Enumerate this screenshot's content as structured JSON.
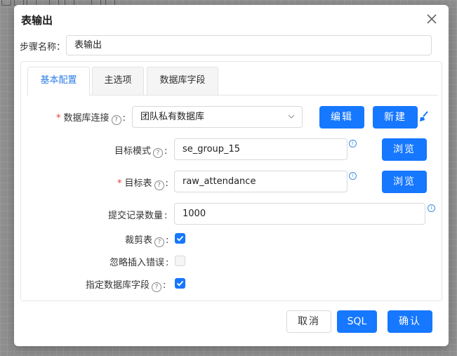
{
  "dialog": {
    "title": "表输出",
    "step_name_label": "步骤名称：",
    "step_name_value": "表输出"
  },
  "tabs": [
    {
      "label": "基本配置",
      "active": true
    },
    {
      "label": "主选项",
      "active": false
    },
    {
      "label": "数据库字段",
      "active": false
    }
  ],
  "form": {
    "db_connection": {
      "label": "数据库连接",
      "required": true,
      "value": "团队私有数据库"
    },
    "target_schema": {
      "label": "目标模式",
      "required": false,
      "value": "se_group_15"
    },
    "target_table": {
      "label": "目标表",
      "required": true,
      "value": "raw_attendance"
    },
    "commit_size": {
      "label": "提交记录数量",
      "value": "1000"
    },
    "truncate_table": {
      "label": "裁剪表",
      "checked": true
    },
    "ignore_insert_errors": {
      "label": "忽略插入错误",
      "checked": false
    },
    "specify_db_fields": {
      "label": "指定数据库字段",
      "checked": true
    }
  },
  "buttons": {
    "edit": "编辑",
    "new": "新建",
    "browse_schema": "浏览",
    "browse_table": "浏览",
    "cancel": "取消",
    "sql": "SQL",
    "confirm": "确认"
  },
  "colors": {
    "primary": "#1677ff",
    "active_tab_text": "#2b7de9",
    "required": "#e53935"
  },
  "icons": [
    "close-icon",
    "question-icon",
    "chevron-down-icon",
    "info-icon",
    "brush-icon",
    "checkmark-icon"
  ]
}
